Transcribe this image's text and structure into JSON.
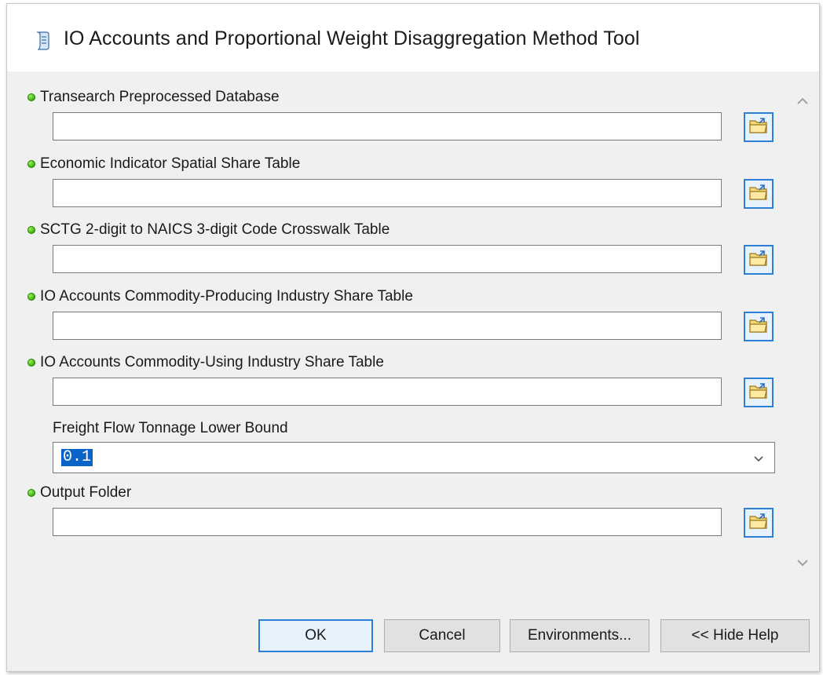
{
  "window": {
    "title": "IO Accounts and Proportional Weight Disaggregation Method Tool",
    "title_icon": "script-tool-icon"
  },
  "params": [
    {
      "label": "Transearch Preprocessed Database",
      "required": true,
      "value": ""
    },
    {
      "label": "Economic Indicator Spatial Share Table",
      "required": true,
      "value": ""
    },
    {
      "label": "SCTG 2-digit to NAICS 3-digit Code Crosswalk Table",
      "required": true,
      "value": ""
    },
    {
      "label": "IO Accounts Commodity-Producing Industry Share Table",
      "required": true,
      "value": ""
    },
    {
      "label": "IO Accounts Commodity-Using Industry Share Table",
      "required": true,
      "value": ""
    }
  ],
  "lower_bound": {
    "label": "Freight Flow Tonnage Lower Bound",
    "value": "0.1"
  },
  "output": {
    "label": "Output Folder",
    "required": true,
    "value": ""
  },
  "buttons": {
    "ok": "OK",
    "cancel": "Cancel",
    "environments": "Environments...",
    "hide_help": "<< Hide Help"
  },
  "colors": {
    "required_dot": "#2fa30b",
    "focus_border": "#2b7fd6",
    "selection": "#0a64c8"
  }
}
